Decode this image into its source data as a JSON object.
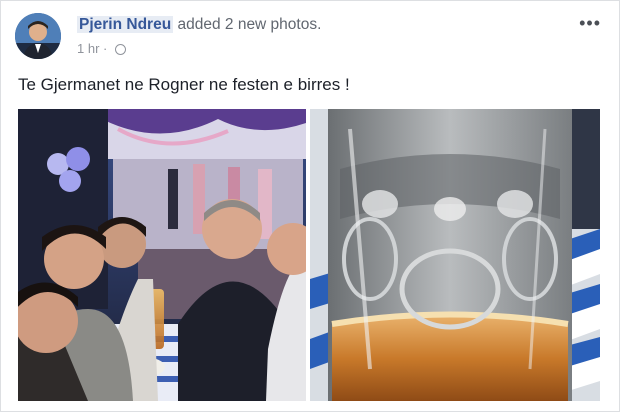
{
  "post": {
    "author_name": "Pjerin Ndreu",
    "action_text": "added 2 new photos.",
    "timestamp": "1 hr",
    "separator": "·",
    "privacy_icon": "globe-icon",
    "menu_icon": "more-options-icon",
    "menu_label": "•••",
    "caption": "Te Gjermanet ne Rogner ne festen e birres !"
  },
  "photos": [
    {
      "subject": "party-selfie-photo"
    },
    {
      "subject": "beer-mug-photo"
    }
  ],
  "colors": {
    "link": "#365899",
    "meta": "#90949c",
    "text": "#1d2129",
    "beer": "#c8792a",
    "tablecloth": "#2a5fb8"
  }
}
